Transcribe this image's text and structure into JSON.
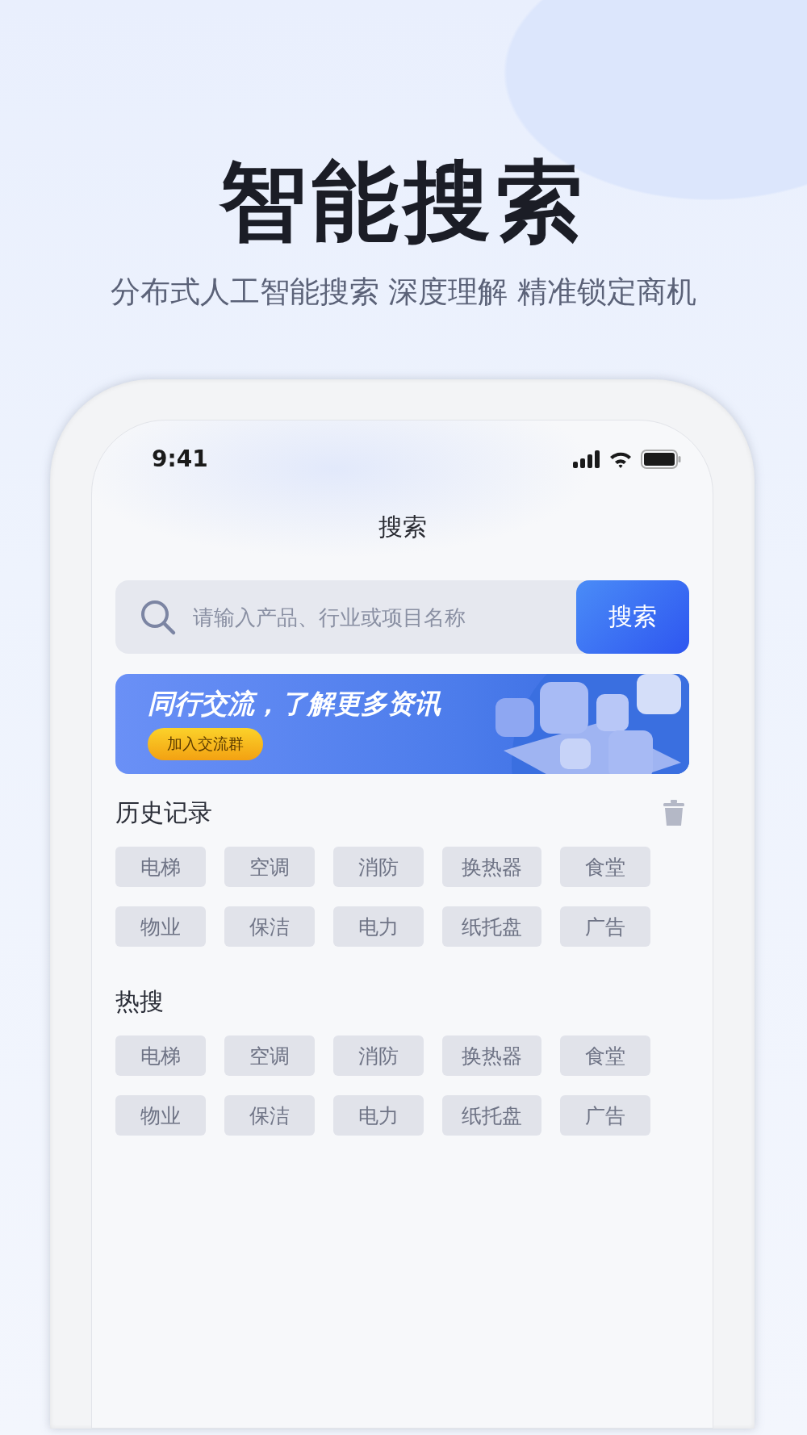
{
  "headline": "智能搜索",
  "tagline": "分布式人工智能搜索 深度理解 精准锁定商机",
  "phone": {
    "status_bar": {
      "time": "9:41"
    },
    "nav_title": "搜索",
    "search": {
      "placeholder": "请输入产品、行业或项目名称",
      "button": "搜索"
    },
    "banner": {
      "title": "同行交流，了解更多资讯",
      "button": "加入交流群"
    },
    "history": {
      "title": "历史记录",
      "tags": [
        "电梯",
        "空调",
        "消防",
        "换热器",
        "食堂",
        "物业",
        "保洁",
        "电力",
        "纸托盘",
        "广告"
      ]
    },
    "hot": {
      "title": "热搜",
      "tags": [
        "电梯",
        "空调",
        "消防",
        "换热器",
        "食堂",
        "物业",
        "保洁",
        "电力",
        "纸托盘",
        "广告"
      ]
    }
  }
}
